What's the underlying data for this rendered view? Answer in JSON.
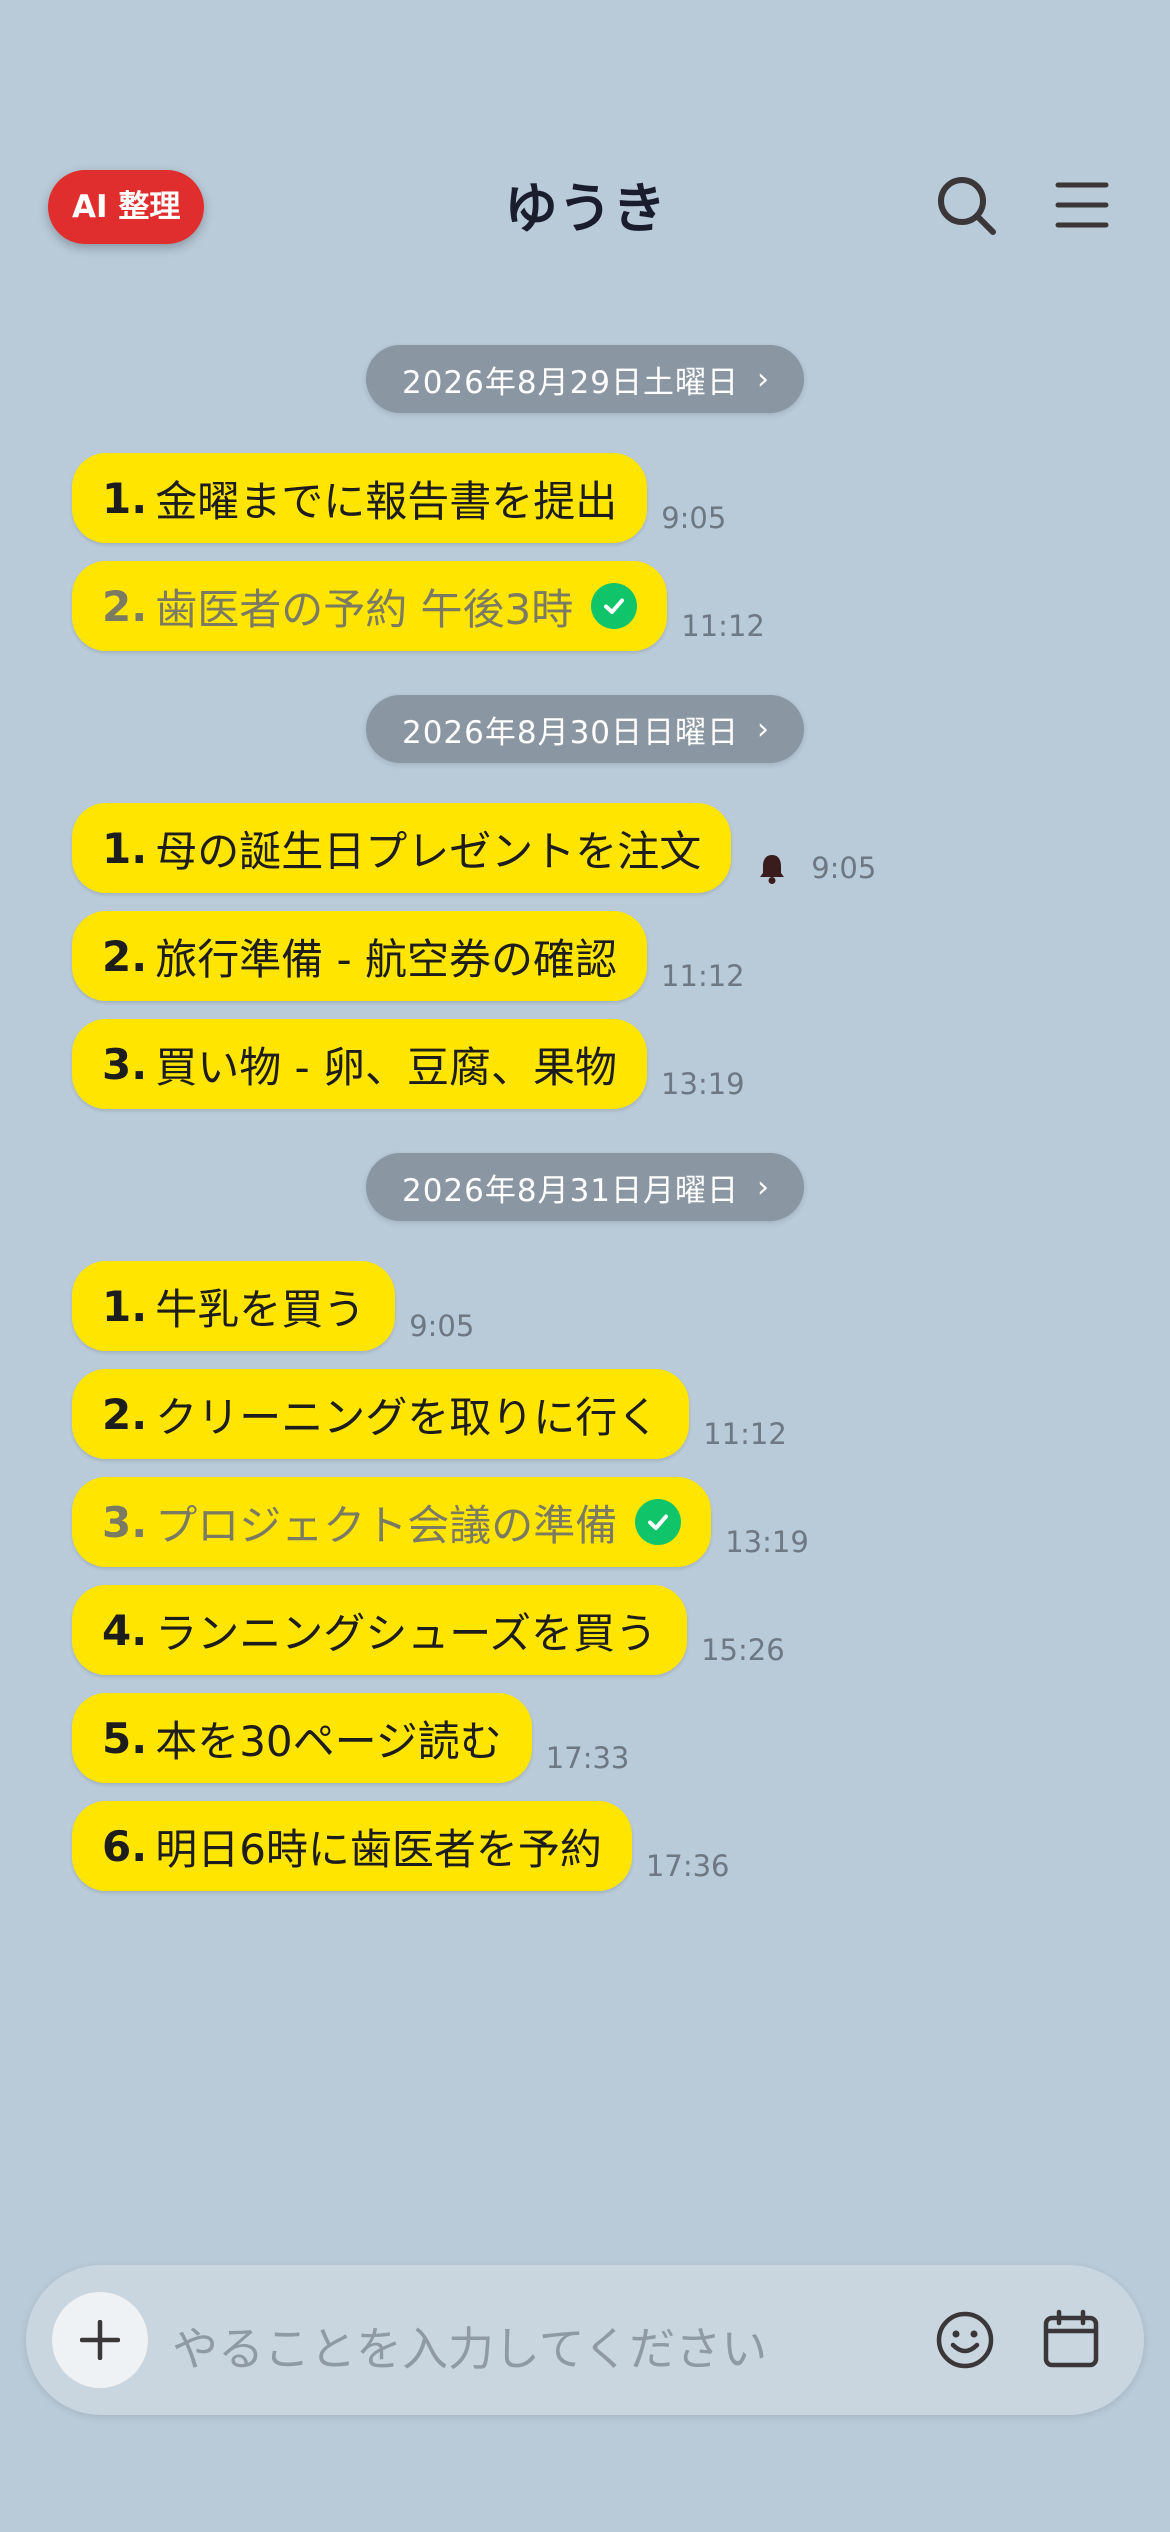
{
  "header": {
    "ai_button": "AI 整理",
    "title": "ゆうき"
  },
  "days": [
    {
      "date": "2026年8月29日土曜日",
      "messages": [
        {
          "num": "1.",
          "text": "金曜までに報告書を提出",
          "time": "9:05"
        },
        {
          "num": "2.",
          "text": "歯医者の予約 午後3時",
          "time": "11:12",
          "done": true
        }
      ]
    },
    {
      "date": "2026年8月30日日曜日",
      "messages": [
        {
          "num": "1.",
          "text": "母の誕生日プレゼントを注文",
          "time": "9:05",
          "reminder": true
        },
        {
          "num": "2.",
          "text": "旅行準備 - 航空券の確認",
          "time": "11:12"
        },
        {
          "num": "3.",
          "text": "買い物 - 卵、豆腐、果物",
          "time": "13:19"
        }
      ]
    },
    {
      "date": "2026年8月31日月曜日",
      "messages": [
        {
          "num": "1.",
          "text": "牛乳を買う",
          "time": "9:05"
        },
        {
          "num": "2.",
          "text": "クリーニングを取りに行く",
          "time": "11:12"
        },
        {
          "num": "3.",
          "text": "プロジェクト会議の準備",
          "time": "13:19",
          "done": true
        },
        {
          "num": "4.",
          "text": "ランニングシューズを買う",
          "time": "15:26"
        },
        {
          "num": "5.",
          "text": "本を30ページ読む",
          "time": "17:33"
        },
        {
          "num": "6.",
          "text": "明日6時に歯医者を予約",
          "time": "17:36"
        }
      ]
    }
  ],
  "input": {
    "placeholder": "やることを入力してください"
  },
  "colors": {
    "background": "#b9cad8",
    "bubble": "#ffe500",
    "ai_button": "#e02e2e",
    "check": "#10c46a",
    "date_pill": "#8a97a3"
  }
}
